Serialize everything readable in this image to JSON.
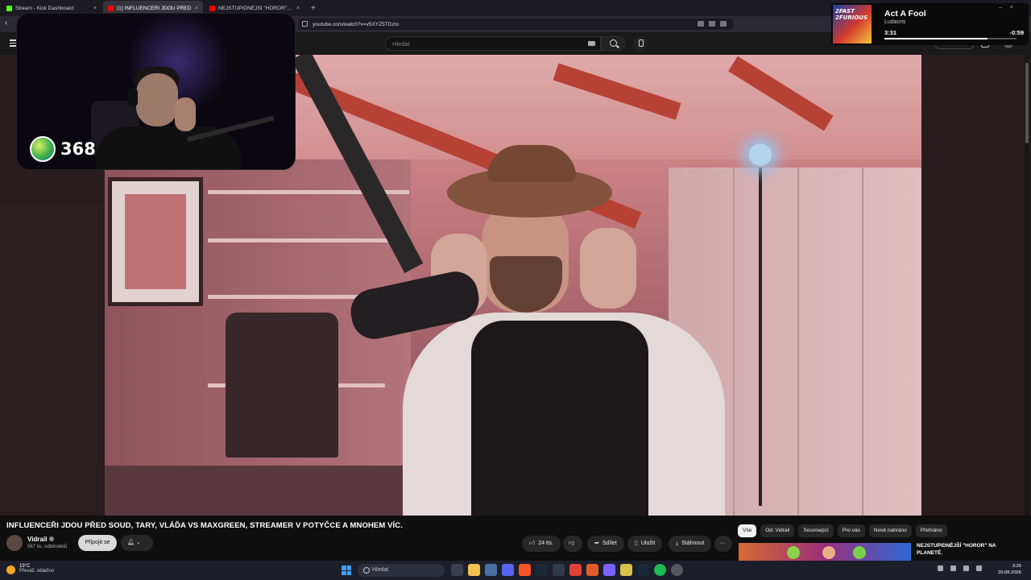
{
  "browser": {
    "tabs": [
      {
        "label": "Stream - Kick Dashboard",
        "color": "#53fc18"
      },
      {
        "label": "(1) INFLUENCEŘI JDOU PŘED",
        "color": "#ff0000"
      },
      {
        "label": "NEJSTUPIDNĚJŠÍ \"HOROR\" NA PLAN",
        "color": "#ff0000"
      }
    ],
    "url": "youtube.com/watch?v=v5XYZ5TDzro"
  },
  "youtube": {
    "search_placeholder": "Hledat"
  },
  "webcam": {
    "viewer_count": "368"
  },
  "now_playing": {
    "title": "Act A Fool",
    "artist": "Ludacris",
    "elapsed": "3:31",
    "remaining": "-0:59",
    "progress": 0.78,
    "cover_text": "2FAST 2FURIOUS"
  },
  "video": {
    "title": "INFLUENCEŘI JDOU PŘED SOUD, TARY, VLÁĎA VS MAXGREEN, STREAMER V POTYČCE A MNOHEM VÍC.",
    "channel": "Vidrail",
    "subscribers": "567 tis. odběratelů",
    "join_label": "Připojit se",
    "likes": "24 tis.",
    "share_label": "Sdílet",
    "save_label": "Uložit",
    "download_label": "Stáhnout"
  },
  "related": {
    "chips": [
      "Vše",
      "Od: Vidrail",
      "Související",
      "Pro vás",
      "Nově nahráno",
      "Přehráno"
    ],
    "first_title": "NEJSTUPIDNĚJŠÍ \"HOROR\" NA PLANETĚ."
  },
  "taskbar": {
    "temperature": "19°C",
    "weather": "Převáž. oblačno",
    "search_placeholder": "Hledat",
    "time": "3:26",
    "date": "20.08.2026"
  }
}
